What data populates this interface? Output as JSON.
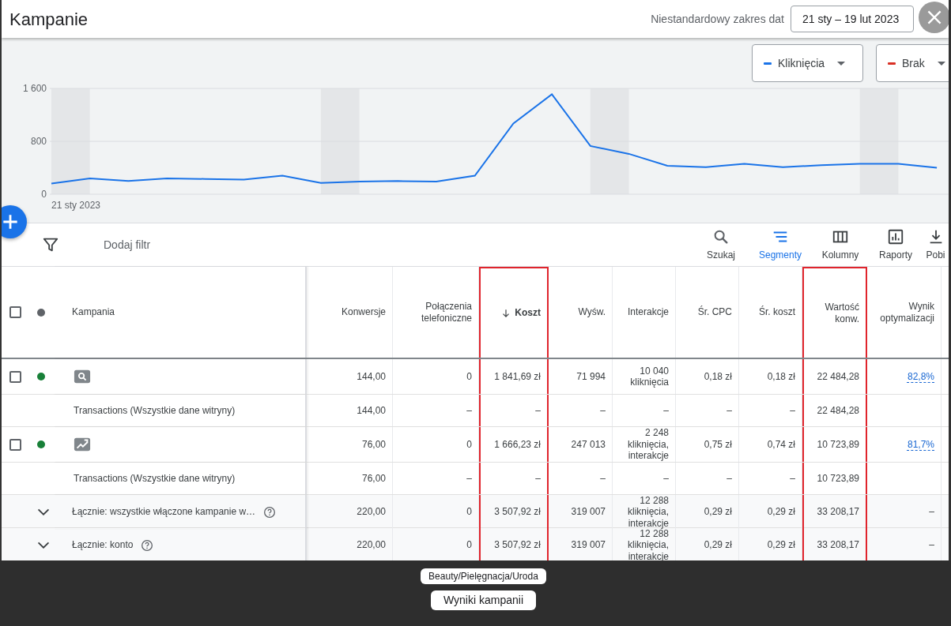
{
  "window": {
    "title": "Kampanie"
  },
  "date_range": {
    "label": "Niestandardowy zakres dat",
    "value": "21 sty – 19 lut 2023"
  },
  "metrics": [
    {
      "label": "Kliknięcia",
      "color": "#1a73e8"
    },
    {
      "label": "Brak",
      "color": "#d93025"
    }
  ],
  "chart": {
    "start_date": "21 sty 2023",
    "chart_data": {
      "type": "line",
      "categories": [
        null,
        null,
        null,
        null,
        null,
        null,
        null,
        null,
        null,
        null,
        null,
        null,
        null,
        null,
        null,
        null,
        null,
        null,
        null,
        null,
        null,
        null,
        null,
        null
      ],
      "series": [
        {
          "color": "#1a73e8",
          "values": [
            160,
            240,
            200,
            240,
            230,
            220,
            280,
            170,
            190,
            200,
            190,
            280,
            1070,
            1510,
            730,
            610,
            430,
            410,
            460,
            410,
            440,
            460,
            460,
            400
          ]
        }
      ],
      "ylim": [
        0,
        1600
      ],
      "yticks": [
        {
          "value": 0,
          "label": "0"
        },
        {
          "value": 800,
          "label": "800"
        },
        {
          "value": 1600,
          "label": "1 600"
        }
      ]
    }
  },
  "toolbar": {
    "filter_placeholder": "Dodaj filtr",
    "actions": [
      {
        "kind": "search",
        "label": "Szukaj",
        "selected": false
      },
      {
        "kind": "segments",
        "label": "Segmenty",
        "selected": true
      },
      {
        "kind": "columns",
        "label": "Kolumny",
        "selected": false
      },
      {
        "kind": "reports",
        "label": "Raporty",
        "selected": false
      },
      {
        "kind": "download",
        "label": "Pobi",
        "selected": false
      }
    ]
  },
  "table": {
    "select_all": {
      "checked": false
    },
    "columns": [
      {
        "label": "Kampania",
        "sorted": false,
        "highlighted": false
      },
      {
        "label": "Konwersje",
        "sorted": false,
        "highlighted": false
      },
      {
        "label": "Połączenia telefoniczne",
        "sorted": false,
        "highlighted": false
      },
      {
        "label": "Koszt",
        "sorted": true,
        "highlighted": true
      },
      {
        "label": "Wyśw.",
        "sorted": false,
        "highlighted": false
      },
      {
        "label": "Interakcje",
        "sorted": false,
        "highlighted": false
      },
      {
        "label": "Śr. CPC",
        "sorted": false,
        "highlighted": false
      },
      {
        "label": "Śr. koszt",
        "sorted": false,
        "highlighted": false
      },
      {
        "label": "Wartość konw.",
        "sorted": false,
        "highlighted": true
      },
      {
        "label": "Wynik optymalizacji",
        "sorted": false,
        "highlighted": false
      }
    ],
    "rows": [
      {
        "kind": "search_campaign",
        "checked": false,
        "color": "#188038",
        "cells": [
          "",
          "144,00",
          "0",
          "1 841,69 zł",
          "71 994",
          "10 040 kliknięcia",
          "0,18 zł",
          "0,18 zł",
          "22 484,28",
          "82,8%"
        ]
      },
      {
        "kind": "conversion",
        "cells": [
          "Transactions (Wszystkie dane witryny)",
          "144,00",
          "–",
          "–",
          "–",
          "–",
          "–",
          "–",
          "22 484,28"
        ]
      },
      {
        "kind": "display_campaign",
        "checked": false,
        "color": "#188038",
        "cells": [
          "",
          "76,00",
          "0",
          "1 666,23 zł",
          "247 013",
          "2 248 kliknięcia, interakcje",
          "0,75 zł",
          "0,74 zł",
          "10 723,89",
          "81,7%"
        ]
      },
      {
        "kind": "conversion",
        "cells": [
          "Transactions (Wszystkie dane witryny)",
          "76,00",
          "–",
          "–",
          "–",
          "–",
          "–",
          "–",
          "10 723,89"
        ]
      },
      {
        "kind": "total",
        "cells": [
          "Łącznie: wszystkie włączone kampanie w…",
          "220,00",
          "0",
          "3 507,92 zł",
          "319 007",
          "12 288 kliknięcia, interakcje",
          "0,29 zł",
          "0,29 zł",
          "33 208,17",
          "–"
        ]
      },
      {
        "kind": "total",
        "cells": [
          "Łącznie: konto",
          "220,00",
          "0",
          "3 507,92 zł",
          "319 007",
          "12 288 kliknięcia, interakcje",
          "0,29 zł",
          "0,29 zł",
          "33 208,17",
          "–"
        ]
      }
    ]
  },
  "overlay_tags": [
    "Beauty/Pielęgnacja/Uroda",
    "Wyniki kampanii"
  ]
}
